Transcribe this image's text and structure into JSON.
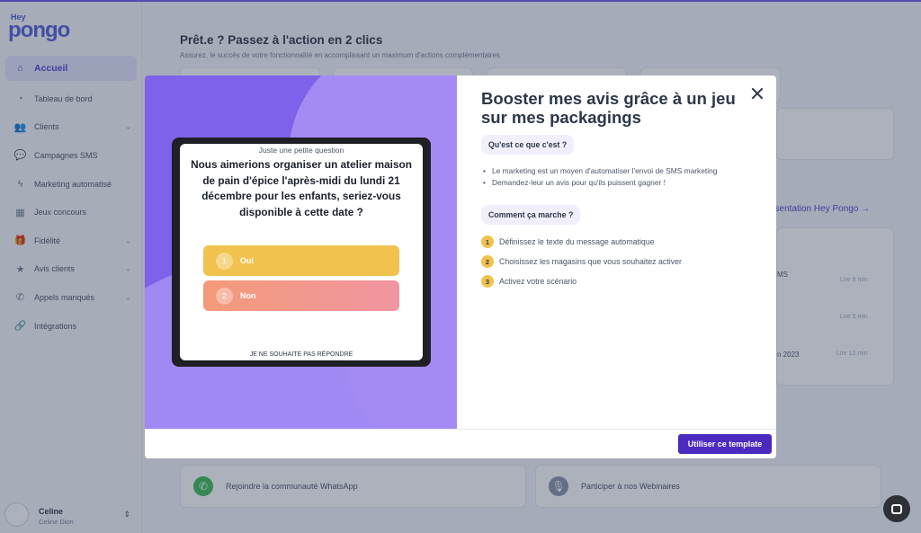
{
  "app": {
    "logo_top": "Hey",
    "logo_main": "pongo",
    "brand_color": "#4b48d1"
  },
  "sidebar": {
    "items": [
      {
        "label": "Accueil",
        "icon": "home-icon",
        "active": true,
        "chevron": false
      },
      {
        "label": "Tableau de bord",
        "icon": "pie-chart-icon",
        "chevron": false
      },
      {
        "label": "Clients",
        "icon": "users-icon",
        "chevron": true
      },
      {
        "label": "Campagnes SMS",
        "icon": "message-icon",
        "chevron": false
      },
      {
        "label": "Marketing automatisé",
        "icon": "bolt-icon",
        "chevron": false
      },
      {
        "label": "Jeux concours",
        "icon": "qr-code-icon",
        "chevron": false
      },
      {
        "label": "Fidélité",
        "icon": "gift-icon",
        "chevron": true
      },
      {
        "label": "Avis clients",
        "icon": "star-icon",
        "chevron": true
      },
      {
        "label": "Appels manqués",
        "icon": "phone-icon",
        "chevron": true
      },
      {
        "label": "Intégrations",
        "icon": "link-icon",
        "chevron": false
      }
    ],
    "user": {
      "name": "Celine",
      "subtitle": "Celine Dion"
    }
  },
  "main": {
    "title": "Prêt.e ? Passez à l'action en 2 clics",
    "subtitle": "Assurez, le succès de votre fonctionnalité en accomplissant un maximum d'actions complémentaires",
    "presentation_link": "ésentation Hey Pongo →",
    "right_rows": [
      {
        "text": "MS",
        "time": "Lire 8 min"
      },
      {
        "text": "",
        "time": "Lire 5 min"
      },
      {
        "text": "n 2023",
        "time": "Lire 12 min"
      }
    ],
    "bottom_cards": [
      {
        "label": "Rejoindre la communauté WhatsApp",
        "icon": "whatsapp-icon"
      },
      {
        "label": "Participer à nos Webinaires",
        "icon": "microphone-icon"
      }
    ]
  },
  "modal": {
    "title": "Booster mes avis grâce à un jeu sur mes packagings",
    "what_label": "Qu'est ce que c'est ?",
    "bullets": [
      "Le marketing est un moyen d'automatiser l'envoi de SMS marketing",
      "Demandez-leur un avis pour qu'ils puissent gagner !"
    ],
    "how_label": "Comment ça marche ?",
    "steps": [
      {
        "num": "1",
        "text": "Définissez le texte du message automatique"
      },
      {
        "num": "2",
        "text": "Choisissez les magasins que vous souhaitez activer"
      },
      {
        "num": "3",
        "text": "Activez votre scénario"
      }
    ],
    "cta": "Utiliser ce template",
    "preview": {
      "small_question": "Juste une petite question",
      "question": "Nous aimerions organiser un atelier maison de pain d'épice l'après-midi du lundi 21 décembre pour les enfants, seriez-vous disponible à cette date ?",
      "answers": [
        {
          "num": "1",
          "label": "Oui"
        },
        {
          "num": "2",
          "label": "Non"
        }
      ],
      "skip": "JE NE SOUHAITE PAS RÉPONDRE"
    }
  }
}
